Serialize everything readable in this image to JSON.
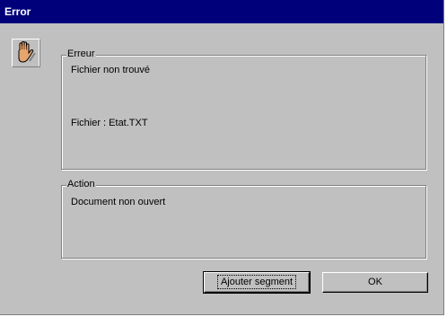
{
  "window": {
    "title": "Error"
  },
  "icon": {
    "name": "stop-hand-icon"
  },
  "erreur_group": {
    "label": "Erreur",
    "message": "Fichier non trouvé",
    "file_line": "Fichier : Etat.TXT"
  },
  "action_group": {
    "label": "Action",
    "message": "Document non ouvert"
  },
  "buttons": {
    "add_segment": "Ajouter segment",
    "ok": "OK"
  },
  "colors": {
    "titlebar": "#00007b",
    "face": "#c0c0c0",
    "hand": "#d9a070"
  }
}
